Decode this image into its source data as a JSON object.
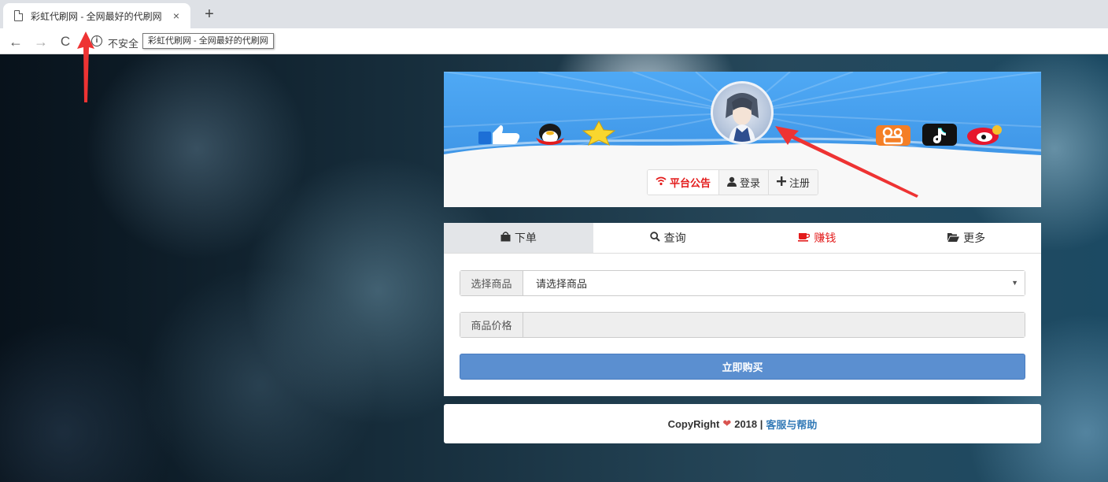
{
  "browser": {
    "tab_title": "彩虹代刷网 - 全网最好的代刷网",
    "tab_close": "×",
    "new_tab": "+",
    "back": "←",
    "forward": "→",
    "reload": "C",
    "info_glyph": "i",
    "security_label": "不安全",
    "tooltip": "彩虹代刷网 - 全网最好的代刷网"
  },
  "header": {
    "buttons": [
      {
        "label": "平台公告",
        "icon": "wifi-icon"
      },
      {
        "label": "登录",
        "icon": "user-icon"
      },
      {
        "label": "注册",
        "icon": "plus-icon"
      }
    ]
  },
  "tabs": [
    {
      "label": "下单",
      "icon": "shopping-bag-icon"
    },
    {
      "label": "查询",
      "icon": "search-icon"
    },
    {
      "label": "赚钱",
      "icon": "coffee-icon"
    },
    {
      "label": "更多",
      "icon": "folder-open-icon"
    }
  ],
  "form": {
    "product_label": "选择商品",
    "product_value": "请选择商品",
    "price_label": "商品价格",
    "price_value": "",
    "buy_button": "立即购买"
  },
  "footer": {
    "copyright": "CopyRight",
    "heart": "❤",
    "year": "2018 |",
    "help_link": "客服与帮助"
  },
  "colors": {
    "banner_blue": "#4aa3f0",
    "accent_red": "#e31b1b",
    "button_blue": "#5b8fd0",
    "link_blue": "#337ab7"
  }
}
